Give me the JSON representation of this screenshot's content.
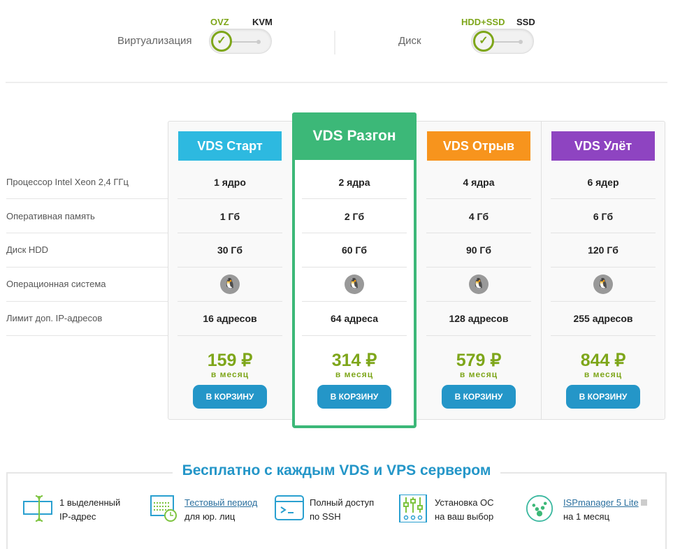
{
  "filters": {
    "virtualization": {
      "label": "Виртуализация",
      "options": [
        "OVZ",
        "KVM"
      ],
      "selected": "OVZ"
    },
    "disk": {
      "label": "Диск",
      "options": [
        "HDD+SSD",
        "SSD"
      ],
      "selected": "HDD+SSD"
    }
  },
  "rows": [
    "Процессор Intel Xeon 2,4 ГГц",
    "Оперативная память",
    "Диск HDD",
    "Операционная система",
    "Лимит доп. IP-адресов"
  ],
  "plans": [
    {
      "name": "VDS Старт",
      "color": "#2db9e0",
      "cpu": "1 ядро",
      "ram": "1 Гб",
      "disk": "30 Гб",
      "os_icon": "linux-icon",
      "ip": "16 адресов",
      "price": "159 ₽",
      "period": "в месяц",
      "button": "В КОРЗИНУ"
    },
    {
      "name": "VDS Разгон",
      "color": "#3cb878",
      "cpu": "2 ядра",
      "ram": "2 Гб",
      "disk": "60 Гб",
      "os_icon": "linux-icon",
      "ip": "64 адреса",
      "price": "314 ₽",
      "period": "в месяц",
      "button": "В КОРЗИНУ"
    },
    {
      "name": "VDS Отрыв",
      "color": "#f7941d",
      "cpu": "4 ядра",
      "ram": "4 Гб",
      "disk": "90 Гб",
      "os_icon": "linux-icon",
      "ip": "128 адресов",
      "price": "579 ₽",
      "period": "в месяц",
      "button": "В КОРЗИНУ"
    },
    {
      "name": "VDS Улёт",
      "color": "#8e44c1",
      "cpu": "6 ядер",
      "ram": "6 Гб",
      "disk": "120 Гб",
      "os_icon": "linux-icon",
      "ip": "255 адресов",
      "price": "844 ₽",
      "period": "в месяц",
      "button": "В КОРЗИНУ"
    }
  ],
  "free": {
    "title": "Бесплатно с каждым VDS и VPS сервером",
    "items": [
      {
        "line1": "1 выделенный",
        "line2": "IP-адрес"
      },
      {
        "line1": "Тестовый период",
        "line2": "для юр. лиц",
        "link": true
      },
      {
        "line1": "Полный доступ",
        "line2": "по SSH"
      },
      {
        "line1": "Установка ОС",
        "line2": "на ваш выбор"
      },
      {
        "line1": "ISPmanager 5 Lite",
        "line2": "на 1 месяц",
        "link": true
      }
    ]
  }
}
